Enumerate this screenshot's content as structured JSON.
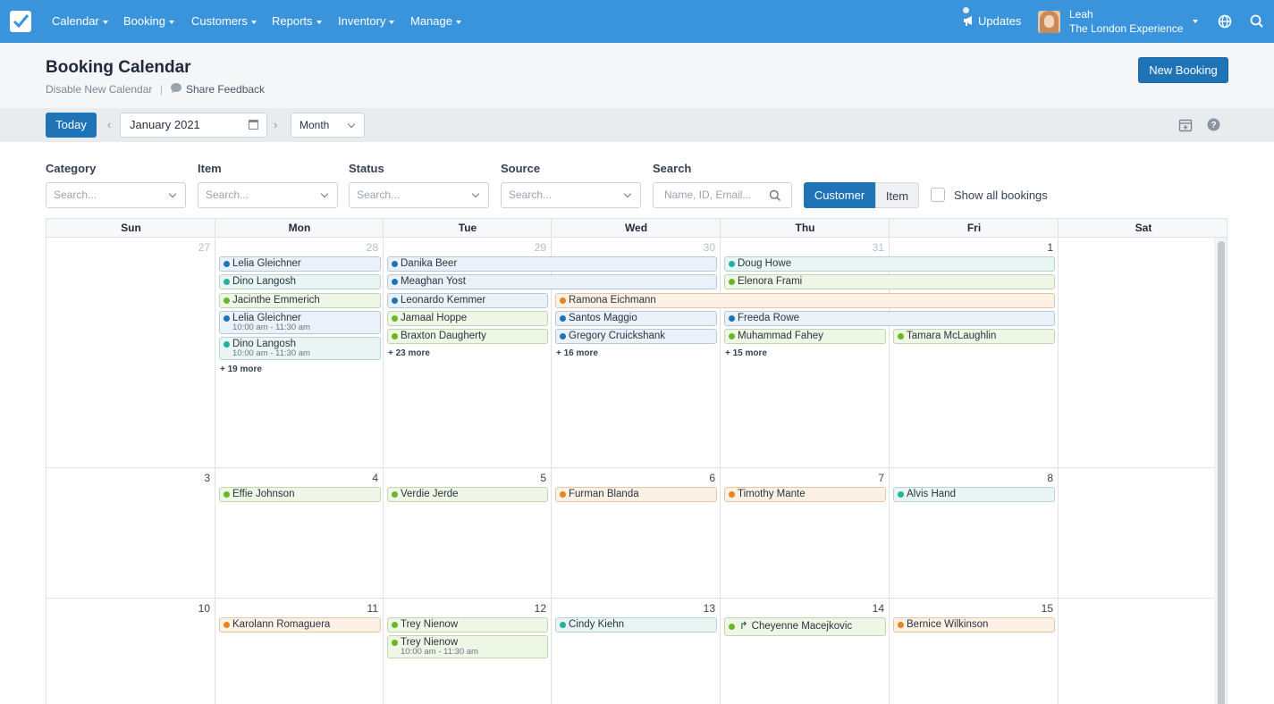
{
  "nav": {
    "items": [
      {
        "label": "Calendar"
      },
      {
        "label": "Booking"
      },
      {
        "label": "Customers"
      },
      {
        "label": "Reports"
      },
      {
        "label": "Inventory"
      },
      {
        "label": "Manage"
      }
    ],
    "updates_label": "Updates",
    "user_name": "Leah",
    "user_org": "The London Experience"
  },
  "header": {
    "title": "Booking Calendar",
    "disable_link": "Disable New Calendar",
    "separator": "|",
    "feedback_link": "Share Feedback",
    "new_booking_label": "New Booking"
  },
  "toolbar": {
    "today_label": "Today",
    "prev": "‹",
    "next": "›",
    "month_value": "January 2021",
    "view_value": "Month"
  },
  "filters": {
    "category": {
      "label": "Category",
      "placeholder": "Search..."
    },
    "item": {
      "label": "Item",
      "placeholder": "Search..."
    },
    "status": {
      "label": "Status",
      "placeholder": "Search..."
    },
    "source": {
      "label": "Source",
      "placeholder": "Search..."
    },
    "search": {
      "label": "Search",
      "placeholder": "Name, ID, Email..."
    },
    "toggle_customer": "Customer",
    "toggle_item": "Item",
    "show_all_label": "Show all bookings"
  },
  "calendar": {
    "weekdays": [
      "Sun",
      "Mon",
      "Tue",
      "Wed",
      "Thu",
      "Fri",
      "Sat"
    ],
    "weeks": [
      {
        "days": [
          "27",
          "28",
          "29",
          "30",
          "31",
          "1",
          ""
        ]
      },
      {
        "days": [
          "3",
          "4",
          "5",
          "6",
          "7",
          "8",
          ""
        ]
      },
      {
        "days": [
          "10",
          "11",
          "12",
          "13",
          "14",
          "15",
          ""
        ]
      }
    ],
    "events": [
      {
        "name": "Lelia Gleichner",
        "color": "blue"
      },
      {
        "name": "Dino Langosh",
        "color": "teal"
      },
      {
        "name": "Jacinthe Emmerich",
        "color": "green"
      },
      {
        "name": "Lelia Gleichner",
        "time": "10:00 am - 11:30 am",
        "color": "blue"
      },
      {
        "name": "Dino Langosh",
        "time": "10:00 am - 11:30 am",
        "color": "teal"
      },
      {
        "name": "Danika Beer",
        "color": "blue"
      },
      {
        "name": "Meaghan Yost",
        "color": "blue"
      },
      {
        "name": "Leonardo Kemmer",
        "color": "blue"
      },
      {
        "name": "Jamaal Hoppe",
        "color": "green"
      },
      {
        "name": "Braxton Daugherty",
        "color": "green"
      },
      {
        "name": "Ramona Eichmann",
        "color": "orange"
      },
      {
        "name": "Santos Maggio",
        "color": "blue"
      },
      {
        "name": "Gregory Cruickshank",
        "color": "blue"
      },
      {
        "name": "Doug Howe",
        "color": "teal"
      },
      {
        "name": "Elenora Frami",
        "color": "green"
      },
      {
        "name": "Freeda Rowe",
        "color": "blue"
      },
      {
        "name": "Muhammad Fahey",
        "color": "green"
      },
      {
        "name": "Tamara McLaughlin",
        "color": "green"
      },
      {
        "name": "Effie Johnson",
        "color": "green"
      },
      {
        "name": "Verdie Jerde",
        "color": "green"
      },
      {
        "name": "Furman Blanda",
        "color": "orange"
      },
      {
        "name": "Timothy Mante",
        "color": "orange"
      },
      {
        "name": "Alvis Hand",
        "color": "teal"
      },
      {
        "name": "Karolann Romaguera",
        "color": "orange"
      },
      {
        "name": "Trey Nienow",
        "color": "green"
      },
      {
        "name": "Trey Nienow",
        "time": "10:00 am - 11:30 am",
        "color": "green"
      },
      {
        "name": "Cindy Kiehn",
        "color": "teal"
      },
      {
        "name": "Cheyenne Macejkovic",
        "color": "green"
      },
      {
        "name": "Bernice Wilkinson",
        "color": "orange"
      }
    ],
    "more": [
      "+ 19 more",
      "+ 23 more",
      "+ 16 more",
      "+ 15 more"
    ]
  }
}
